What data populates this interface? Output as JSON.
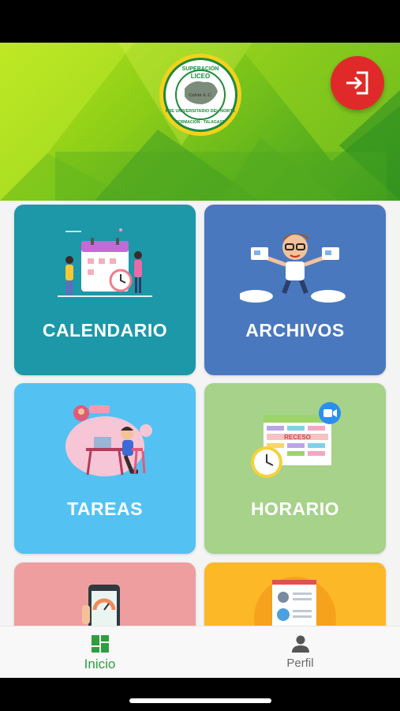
{
  "header": {
    "logo": {
      "top_text": "SUPERACIÓN",
      "inner_text": "LICEO",
      "ring_text": "PRE UNIVERSITARIO DEL NORTE",
      "bottom_text": "FORMACIÓN · TALAGASD",
      "signature": "Calvin A. C."
    },
    "logout_icon": "logout-icon",
    "colors": {
      "accent_red": "#e02a2a",
      "green_light": "#b7e51b",
      "green_dark": "#3d9a20"
    }
  },
  "menu": {
    "cards": [
      {
        "label": "CALENDARIO",
        "color": "#1c98a8"
      },
      {
        "label": "ARCHIVOS",
        "color": "#4a78be"
      },
      {
        "label": "TAREAS",
        "color": "#53c2f2"
      },
      {
        "label": "HORARIO",
        "color": "#a6d28a"
      },
      {
        "label": "",
        "color": "#ee9e9e"
      },
      {
        "label": "",
        "color": "#fdb827"
      }
    ],
    "horario_banner": "RECESO"
  },
  "bottom_nav": {
    "items": [
      {
        "label": "Inicio",
        "icon": "dashboard-icon",
        "active": true,
        "color": "#2e9e3e"
      },
      {
        "label": "Perfil",
        "icon": "person-icon",
        "active": false,
        "color": "#6b6b6b"
      }
    ]
  }
}
